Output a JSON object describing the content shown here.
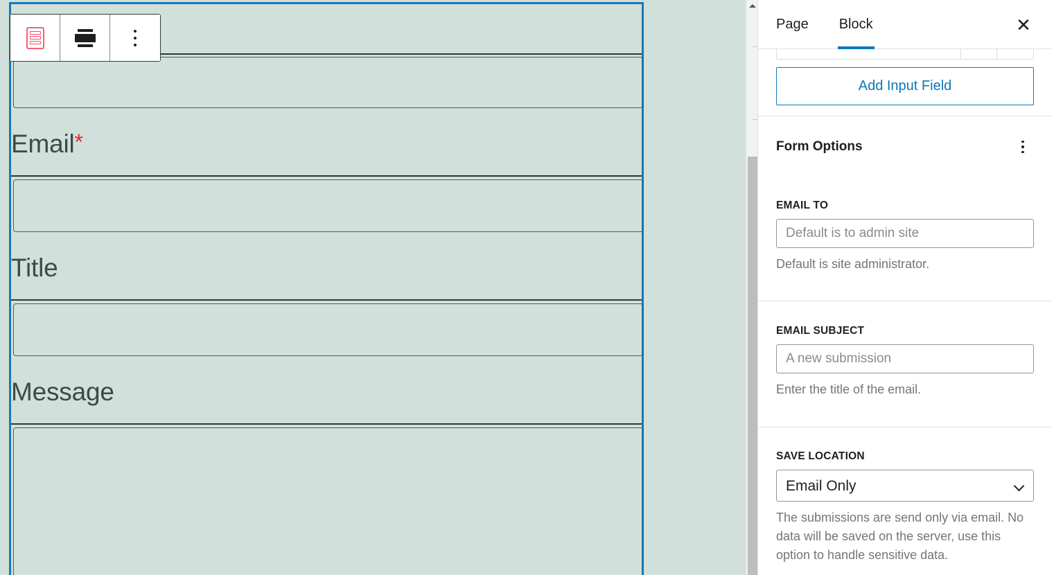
{
  "editor": {
    "background_color": "#d1e0da",
    "selection_color": "#1878b9",
    "block_toolbar": {
      "buttons": [
        {
          "name": "form-block-icon",
          "label": "Form",
          "icon": "form-icon"
        },
        {
          "name": "align-full-width",
          "label": "Align",
          "icon": "align-center-icon"
        },
        {
          "name": "more-options",
          "label": "Options",
          "icon": "kebab-vertical-icon"
        }
      ]
    },
    "form_fields": [
      {
        "label": "",
        "required": false,
        "type": "text"
      },
      {
        "label": "Email",
        "required": true,
        "required_mark": "*",
        "type": "email"
      },
      {
        "label": "Title",
        "required": false,
        "type": "text"
      },
      {
        "label": "Message",
        "required": false,
        "type": "textarea"
      }
    ]
  },
  "sidebar": {
    "tabs": [
      {
        "label": "Page",
        "active": false
      },
      {
        "label": "Block",
        "active": true
      }
    ],
    "close_label": "✕",
    "add_field_button": "Add Input Field",
    "panel": {
      "title": "Form Options",
      "options_menu_label": "Options",
      "settings": [
        {
          "label": "EMAIL TO",
          "control": "input",
          "value": "",
          "placeholder": "Default is to admin site",
          "help": "Default is site administrator."
        },
        {
          "label": "EMAIL SUBJECT",
          "control": "input",
          "value": "",
          "placeholder": "A new submission",
          "help": "Enter the title of the email."
        },
        {
          "label": "SAVE LOCATION",
          "control": "select",
          "value": "Email Only",
          "options": [
            "Email Only"
          ],
          "help": "The submissions are send only via email. No data will be saved on the server, use this option to handle sensitive data."
        }
      ]
    }
  },
  "colors": {
    "accent_blue": "#0b76b8",
    "canvas_green": "#d1e0da",
    "required_red": "#e02b2b",
    "form_icon_pink": "#f3607a"
  }
}
